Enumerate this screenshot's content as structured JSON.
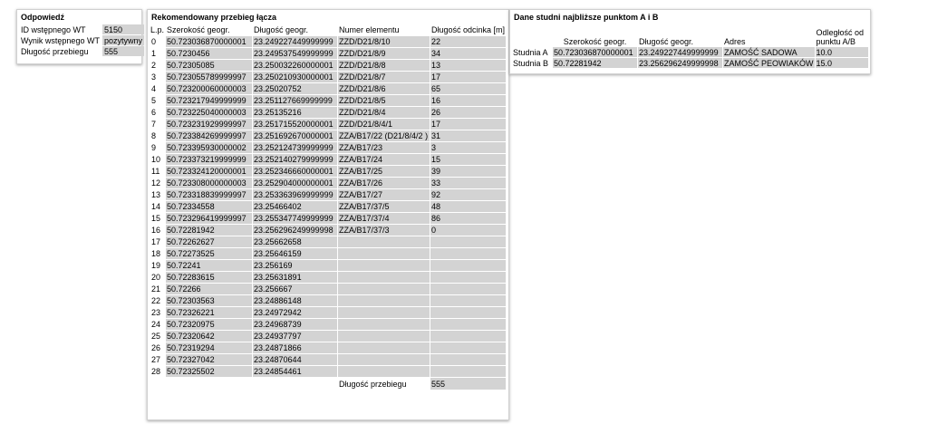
{
  "answer_panel": {
    "title": "Odpowiedź",
    "rows": [
      {
        "label": "ID wstępnego WT",
        "value": "5150"
      },
      {
        "label": "Wynik wstępnego WT",
        "value": "pozytywny"
      },
      {
        "label": "Długość przebiegu",
        "value": "555"
      }
    ]
  },
  "route_panel": {
    "title": "Rekomendowany przebieg łącza",
    "headers": [
      "L.p.",
      "Szerokość geogr.",
      "Długość geogr.",
      "Numer elementu",
      "Długość odcinka [m]"
    ],
    "rows": [
      {
        "lp": "0",
        "lat": "50.723036870000001",
        "lon": "23.249227449999999",
        "element": "ZZD/D21/8/10",
        "length": "22"
      },
      {
        "lp": "1",
        "lat": "50.7230456",
        "lon": "23.249537549999999",
        "element": "ZZD/D21/8/9",
        "length": "34"
      },
      {
        "lp": "2",
        "lat": "50.72305085",
        "lon": "23.250032260000001",
        "element": "ZZD/D21/8/8",
        "length": "13"
      },
      {
        "lp": "3",
        "lat": "50.723055789999997",
        "lon": "23.250210930000001",
        "element": "ZZD/D21/8/7",
        "length": "17"
      },
      {
        "lp": "4",
        "lat": "50.723200060000003",
        "lon": "23.25020752",
        "element": "ZZD/D21/8/6",
        "length": "65"
      },
      {
        "lp": "5",
        "lat": "50.723217949999999",
        "lon": "23.251127669999999",
        "element": "ZZD/D21/8/5",
        "length": "16"
      },
      {
        "lp": "6",
        "lat": "50.723225040000003",
        "lon": "23.25135216",
        "element": "ZZD/D21/8/4",
        "length": "26"
      },
      {
        "lp": "7",
        "lat": "50.723231929999997",
        "lon": "23.251715520000001",
        "element": "ZZD/D21/8/4/1",
        "length": "17"
      },
      {
        "lp": "8",
        "lat": "50.723384269999997",
        "lon": "23.251692670000001",
        "element": "ZZA/B17/22 (D21/8/4/2 )",
        "length": "31"
      },
      {
        "lp": "9",
        "lat": "50.723395930000002",
        "lon": "23.252124739999999",
        "element": "ZZA/B17/23",
        "length": "3"
      },
      {
        "lp": "10",
        "lat": "50.723373219999999",
        "lon": "23.252140279999999",
        "element": "ZZA/B17/24",
        "length": "15"
      },
      {
        "lp": "11",
        "lat": "50.723324120000001",
        "lon": "23.252346660000001",
        "element": "ZZA/B17/25",
        "length": "39"
      },
      {
        "lp": "12",
        "lat": "50.723308000000003",
        "lon": "23.252904000000001",
        "element": "ZZA/B17/26",
        "length": "33"
      },
      {
        "lp": "13",
        "lat": "50.723318839999997",
        "lon": "23.253363969999999",
        "element": "ZZA/B17/27",
        "length": "92"
      },
      {
        "lp": "14",
        "lat": "50.72334558",
        "lon": "23.25466402",
        "element": "ZZA/B17/37/5",
        "length": "48"
      },
      {
        "lp": "15",
        "lat": "50.723296419999997",
        "lon": "23.255347749999999",
        "element": "ZZA/B17/37/4",
        "length": "86"
      },
      {
        "lp": "16",
        "lat": "50.72281942",
        "lon": "23.256296249999998",
        "element": "ZZA/B17/37/3",
        "length": "0"
      },
      {
        "lp": "17",
        "lat": "50.72262627",
        "lon": "23.25662658",
        "element": "",
        "length": ""
      },
      {
        "lp": "18",
        "lat": "50.72273525",
        "lon": "23.25646159",
        "element": "",
        "length": ""
      },
      {
        "lp": "19",
        "lat": "50.72241",
        "lon": "23.256169",
        "element": "",
        "length": ""
      },
      {
        "lp": "20",
        "lat": "50.72283615",
        "lon": "23.25631891",
        "element": "",
        "length": ""
      },
      {
        "lp": "21",
        "lat": "50.72266",
        "lon": "23.256667",
        "element": "",
        "length": ""
      },
      {
        "lp": "22",
        "lat": "50.72303563",
        "lon": "23.24886148",
        "element": "",
        "length": ""
      },
      {
        "lp": "23",
        "lat": "50.72326221",
        "lon": "23.24972942",
        "element": "",
        "length": ""
      },
      {
        "lp": "24",
        "lat": "50.72320975",
        "lon": "23.24968739",
        "element": "",
        "length": ""
      },
      {
        "lp": "25",
        "lat": "50.72320642",
        "lon": "23.24937797",
        "element": "",
        "length": ""
      },
      {
        "lp": "26",
        "lat": "50.72319294",
        "lon": "23.24871866",
        "element": "",
        "length": ""
      },
      {
        "lp": "27",
        "lat": "50.72327042",
        "lon": "23.24870644",
        "element": "",
        "length": ""
      },
      {
        "lp": "28",
        "lat": "50.72325502",
        "lon": "23.24854461",
        "element": "",
        "length": ""
      }
    ],
    "footer_label": "Długość przebiegu",
    "footer_value": "555"
  },
  "wells_panel": {
    "title": "Dane studni najbliższe punktom A i B",
    "headers": [
      "",
      "Szerokość geogr.",
      "Długość geogr.",
      "Adres",
      "Odległość od punktu A/B"
    ],
    "rows": [
      {
        "name": "Studnia A",
        "lat": "50.723036870000001",
        "lon": "23.249227449999999",
        "address": "ZAMOŚĆ SADOWA",
        "distance": "10.0"
      },
      {
        "name": "Studnia B",
        "lat": "50.72281942",
        "lon": "23.256296249999998",
        "address": "ZAMOŚĆ PEOWIAKÓW",
        "distance": "15.0"
      }
    ]
  },
  "colors": {
    "cell_bg": "#d3d3d3",
    "panel_border": "#d0d0d0"
  }
}
